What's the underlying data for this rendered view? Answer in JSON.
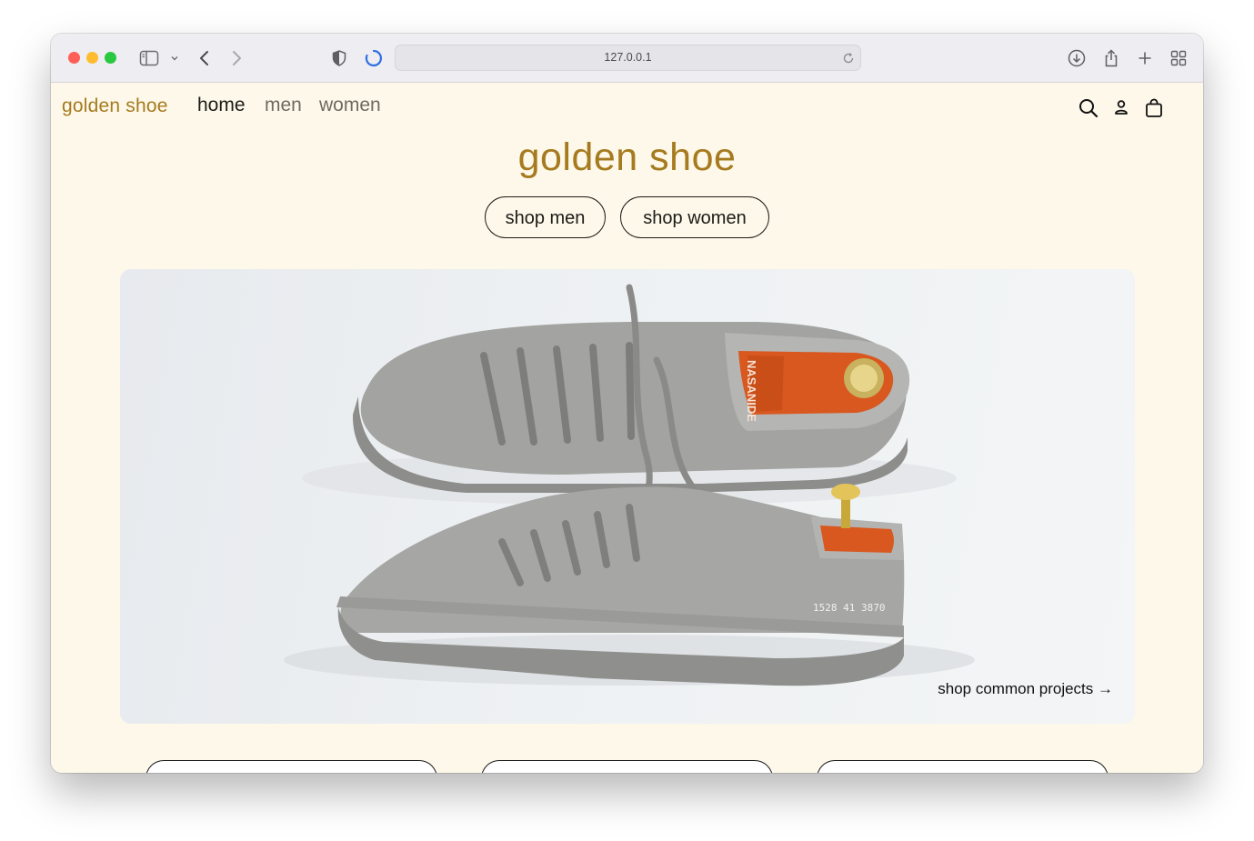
{
  "browser": {
    "url": "127.0.0.1"
  },
  "nav": {
    "logo": "golden shoe",
    "links": [
      "home",
      "men",
      "women"
    ],
    "icons": [
      "search-icon",
      "account-icon",
      "bag-icon"
    ]
  },
  "hero": {
    "title": "golden shoe",
    "buttons": [
      "shop men",
      "shop women"
    ],
    "cta": "shop common projects →",
    "shoe_print": "1528 41 3870",
    "insole_brand": "NASANIDE"
  },
  "colors": {
    "brand": "#a67a1f",
    "background": "#fdf8e9",
    "text": "#1c1b18",
    "nav_muted": "#6e6a60"
  }
}
